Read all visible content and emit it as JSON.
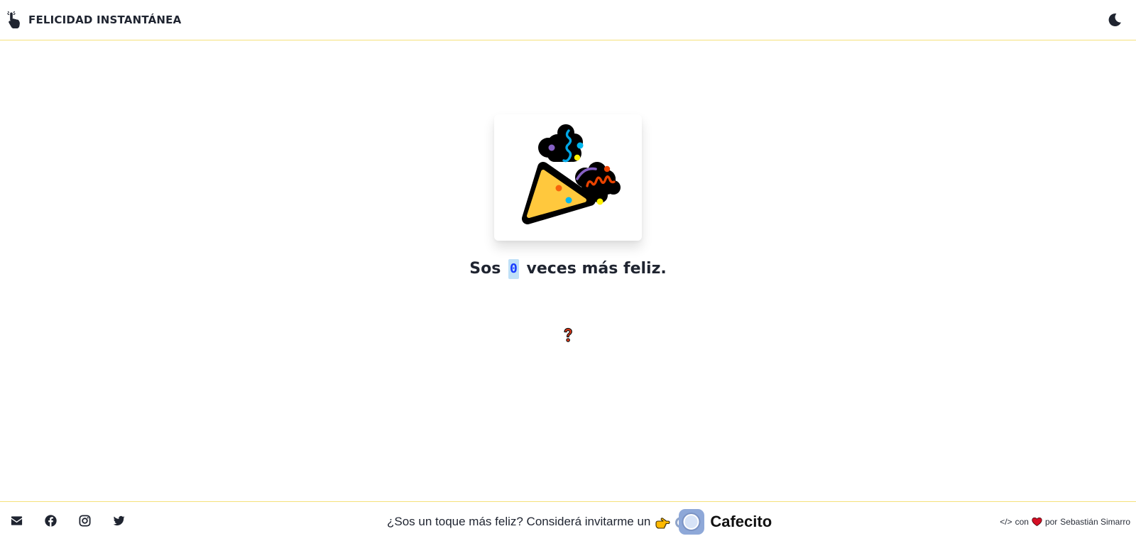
{
  "header": {
    "title": "FELICIDAD INSTANTÁNEA",
    "logo_icon": "pointing-hand-icon",
    "theme_toggle_icon": "moon-icon"
  },
  "main": {
    "emoji_icon": "party-popper-icon",
    "message_prefix": "Sos",
    "counter": "0",
    "message_suffix": "veces más feliz.",
    "help_icon": "question-mark-icon"
  },
  "footer": {
    "social_links": [
      {
        "name": "email",
        "icon": "envelope-icon"
      },
      {
        "name": "facebook",
        "icon": "facebook-icon"
      },
      {
        "name": "instagram",
        "icon": "instagram-icon"
      },
      {
        "name": "twitter",
        "icon": "twitter-icon"
      }
    ],
    "cafecito_prompt": "¿Sos un toque más feliz? Considerá invitarme un",
    "cafecito_label": "Cafecito",
    "credits_code": "</>",
    "credits_con": "con",
    "credits_por": "por",
    "credits_author": "Sebastián Simarro"
  },
  "colors": {
    "accent_border": "#f5e17a",
    "counter_bg": "#bfe0f7",
    "counter_text": "#1a3cff",
    "text": "#1f2430"
  }
}
